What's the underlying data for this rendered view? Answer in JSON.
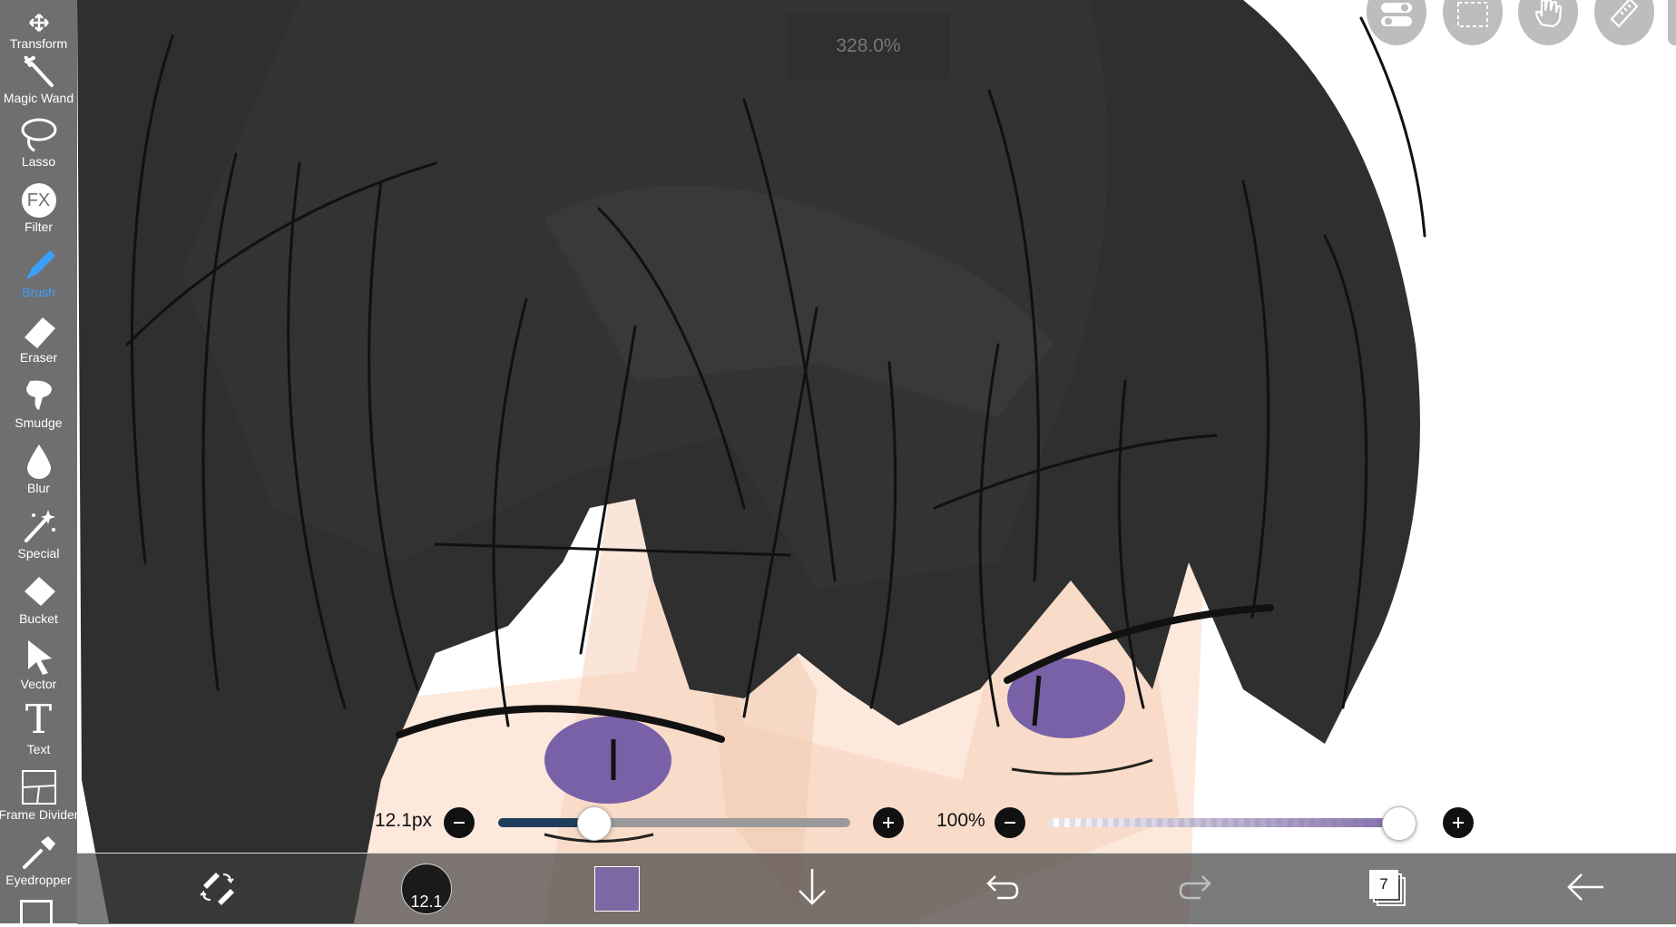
{
  "app": {
    "zoom_label": "328.0%"
  },
  "toolbar": {
    "items": [
      {
        "label": "Transform",
        "icon": "transform-icon"
      },
      {
        "label": "Magic Wand",
        "icon": "magic-wand-icon"
      },
      {
        "label": "Lasso",
        "icon": "lasso-icon"
      },
      {
        "label": "Filter",
        "icon": "fx-icon",
        "glyph": "FX"
      },
      {
        "label": "Brush",
        "icon": "brush-icon",
        "active": true
      },
      {
        "label": "Eraser",
        "icon": "eraser-icon"
      },
      {
        "label": "Smudge",
        "icon": "smudge-icon"
      },
      {
        "label": "Blur",
        "icon": "blur-drop-icon"
      },
      {
        "label": "Special",
        "icon": "special-wand-icon"
      },
      {
        "label": "Bucket",
        "icon": "bucket-icon"
      },
      {
        "label": "Vector",
        "icon": "vector-cursor-icon"
      },
      {
        "label": "Text",
        "icon": "text-icon",
        "glyph": "T"
      },
      {
        "label": "Frame Divider",
        "icon": "frame-divider-icon"
      },
      {
        "label": "Eyedropper",
        "icon": "eyedropper-icon"
      }
    ],
    "active_color": "#3aa0ff"
  },
  "top_buttons": [
    "toggle-icon",
    "selection-icon",
    "hand-icon",
    "ruler-icon"
  ],
  "brush_size": {
    "label": "12.1px",
    "fraction": 0.27,
    "track_color": "#1f3e5e"
  },
  "opacity": {
    "label": "100%",
    "fraction": 1.0,
    "color": "#7e6aa6"
  },
  "bottom_bar": {
    "brush_preview_label": "12.1",
    "current_color": "#7d68a3",
    "layer_count": "7"
  }
}
